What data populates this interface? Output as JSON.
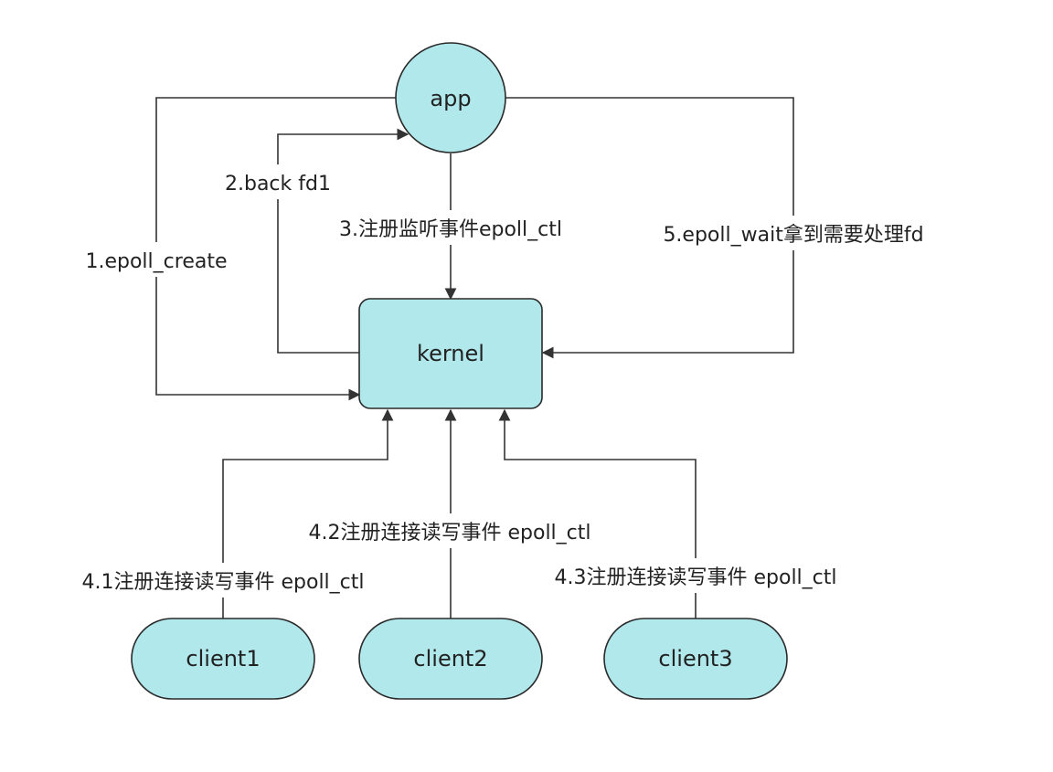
{
  "colors": {
    "node_fill": "#b0e8ec",
    "node_stroke": "#2a2a2a",
    "edge": "#333333",
    "text": "#222222",
    "background": "#ffffff"
  },
  "nodes": {
    "app": "app",
    "kernel": "kernel",
    "client1": "client1",
    "client2": "client2",
    "client3": "client3"
  },
  "edges": {
    "epoll_create": "1.epoll_create",
    "back_fd1": "2.back fd1",
    "register_listen": "3.注册监听事件epoll_ctl",
    "client1_register": "4.1注册连接读写事件 epoll_ctl",
    "client2_register": "4.2注册连接读写事件 epoll_ctl",
    "client3_register": "4.3注册连接读写事件 epoll_ctl",
    "epoll_wait": "5.epoll_wait拿到需要处理fd"
  }
}
